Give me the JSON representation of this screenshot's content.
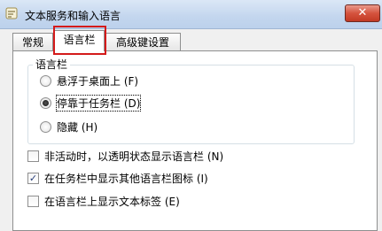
{
  "window": {
    "title": "文本服务和输入语言",
    "close_glyph": "✕"
  },
  "tabs": [
    {
      "label": "常规",
      "active": false
    },
    {
      "label": "语言栏",
      "active": true
    },
    {
      "label": "高级键设置",
      "active": false
    }
  ],
  "language_bar": {
    "group_title": "语言栏",
    "options": [
      {
        "label": "悬浮于桌面上 (F)",
        "selected": false
      },
      {
        "label": "停靠于任务栏 (D)",
        "selected": true
      },
      {
        "label": "隐藏 (H)",
        "selected": false
      }
    ]
  },
  "checkboxes": [
    {
      "label": "非活动时，以透明状态显示语言栏 (N)",
      "checked": false
    },
    {
      "label": "在任务栏中显示其他语言栏图标 (I)",
      "checked": true
    },
    {
      "label": "在语言栏上显示文本标签 (E)",
      "checked": false
    }
  ],
  "colors": {
    "highlight_box": "#d41b1b",
    "close_button": "#c23a24"
  }
}
